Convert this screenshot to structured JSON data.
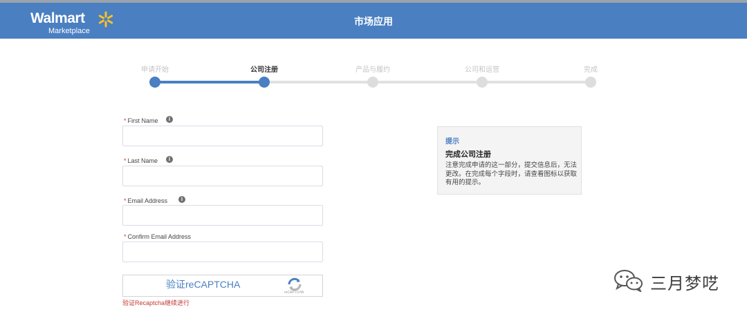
{
  "header": {
    "brand": "Walmart",
    "brand_sub": "Marketplace",
    "title": "市场应用"
  },
  "steps": [
    {
      "label": "申请开始",
      "state": "done"
    },
    {
      "label": "公司注册",
      "state": "active"
    },
    {
      "label": "产品与履约",
      "state": "upcoming"
    },
    {
      "label": "公司和运营",
      "state": "upcoming"
    },
    {
      "label": "完成",
      "state": "upcoming"
    }
  ],
  "form": {
    "required_mark": "*",
    "first_name": {
      "label": "First Name",
      "value": "",
      "info_icon": "info-icon"
    },
    "last_name": {
      "label": "Last Name",
      "value": "",
      "info_icon": "info-icon"
    },
    "email": {
      "label": "Email Address",
      "value": "",
      "info_icon": "info-icon"
    },
    "confirm_email": {
      "label": "Confirm Email Address",
      "value": ""
    }
  },
  "captcha": {
    "label": "验证reCAPTCHA",
    "brand": "reCAPTCHA",
    "error": "验证Recaptcha继续进行"
  },
  "tip": {
    "heading": "提示",
    "title": "完成公司注册",
    "body": "注意完成申请的这一部分，提交信息后，无法更改。在完成每个字段时，请查看图标以获取有用的提示。"
  },
  "watermark": {
    "text": "三月梦呓",
    "icon": "wechat-icon"
  },
  "colors": {
    "header": "#4a7fc1",
    "accent": "#4a7fc1",
    "error": "#c23934",
    "spark": "#ffc220"
  }
}
